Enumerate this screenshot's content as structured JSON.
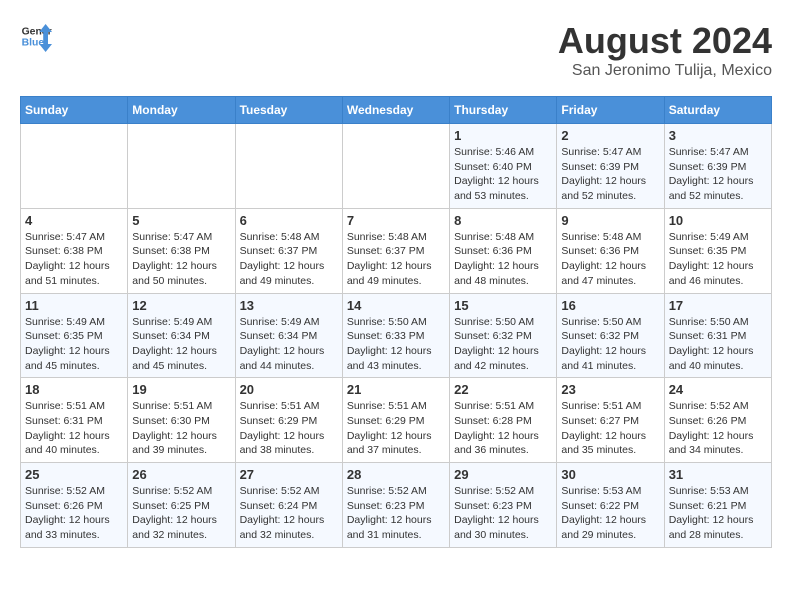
{
  "header": {
    "logo_text_general": "General",
    "logo_text_blue": "Blue",
    "month_year": "August 2024",
    "location": "San Jeronimo Tulija, Mexico"
  },
  "days_of_week": [
    "Sunday",
    "Monday",
    "Tuesday",
    "Wednesday",
    "Thursday",
    "Friday",
    "Saturday"
  ],
  "weeks": [
    [
      {
        "day": "",
        "info": ""
      },
      {
        "day": "",
        "info": ""
      },
      {
        "day": "",
        "info": ""
      },
      {
        "day": "",
        "info": ""
      },
      {
        "day": "1",
        "info": "Sunrise: 5:46 AM\nSunset: 6:40 PM\nDaylight: 12 hours\nand 53 minutes."
      },
      {
        "day": "2",
        "info": "Sunrise: 5:47 AM\nSunset: 6:39 PM\nDaylight: 12 hours\nand 52 minutes."
      },
      {
        "day": "3",
        "info": "Sunrise: 5:47 AM\nSunset: 6:39 PM\nDaylight: 12 hours\nand 52 minutes."
      }
    ],
    [
      {
        "day": "4",
        "info": "Sunrise: 5:47 AM\nSunset: 6:38 PM\nDaylight: 12 hours\nand 51 minutes."
      },
      {
        "day": "5",
        "info": "Sunrise: 5:47 AM\nSunset: 6:38 PM\nDaylight: 12 hours\nand 50 minutes."
      },
      {
        "day": "6",
        "info": "Sunrise: 5:48 AM\nSunset: 6:37 PM\nDaylight: 12 hours\nand 49 minutes."
      },
      {
        "day": "7",
        "info": "Sunrise: 5:48 AM\nSunset: 6:37 PM\nDaylight: 12 hours\nand 49 minutes."
      },
      {
        "day": "8",
        "info": "Sunrise: 5:48 AM\nSunset: 6:36 PM\nDaylight: 12 hours\nand 48 minutes."
      },
      {
        "day": "9",
        "info": "Sunrise: 5:48 AM\nSunset: 6:36 PM\nDaylight: 12 hours\nand 47 minutes."
      },
      {
        "day": "10",
        "info": "Sunrise: 5:49 AM\nSunset: 6:35 PM\nDaylight: 12 hours\nand 46 minutes."
      }
    ],
    [
      {
        "day": "11",
        "info": "Sunrise: 5:49 AM\nSunset: 6:35 PM\nDaylight: 12 hours\nand 45 minutes."
      },
      {
        "day": "12",
        "info": "Sunrise: 5:49 AM\nSunset: 6:34 PM\nDaylight: 12 hours\nand 45 minutes."
      },
      {
        "day": "13",
        "info": "Sunrise: 5:49 AM\nSunset: 6:34 PM\nDaylight: 12 hours\nand 44 minutes."
      },
      {
        "day": "14",
        "info": "Sunrise: 5:50 AM\nSunset: 6:33 PM\nDaylight: 12 hours\nand 43 minutes."
      },
      {
        "day": "15",
        "info": "Sunrise: 5:50 AM\nSunset: 6:32 PM\nDaylight: 12 hours\nand 42 minutes."
      },
      {
        "day": "16",
        "info": "Sunrise: 5:50 AM\nSunset: 6:32 PM\nDaylight: 12 hours\nand 41 minutes."
      },
      {
        "day": "17",
        "info": "Sunrise: 5:50 AM\nSunset: 6:31 PM\nDaylight: 12 hours\nand 40 minutes."
      }
    ],
    [
      {
        "day": "18",
        "info": "Sunrise: 5:51 AM\nSunset: 6:31 PM\nDaylight: 12 hours\nand 40 minutes."
      },
      {
        "day": "19",
        "info": "Sunrise: 5:51 AM\nSunset: 6:30 PM\nDaylight: 12 hours\nand 39 minutes."
      },
      {
        "day": "20",
        "info": "Sunrise: 5:51 AM\nSunset: 6:29 PM\nDaylight: 12 hours\nand 38 minutes."
      },
      {
        "day": "21",
        "info": "Sunrise: 5:51 AM\nSunset: 6:29 PM\nDaylight: 12 hours\nand 37 minutes."
      },
      {
        "day": "22",
        "info": "Sunrise: 5:51 AM\nSunset: 6:28 PM\nDaylight: 12 hours\nand 36 minutes."
      },
      {
        "day": "23",
        "info": "Sunrise: 5:51 AM\nSunset: 6:27 PM\nDaylight: 12 hours\nand 35 minutes."
      },
      {
        "day": "24",
        "info": "Sunrise: 5:52 AM\nSunset: 6:26 PM\nDaylight: 12 hours\nand 34 minutes."
      }
    ],
    [
      {
        "day": "25",
        "info": "Sunrise: 5:52 AM\nSunset: 6:26 PM\nDaylight: 12 hours\nand 33 minutes."
      },
      {
        "day": "26",
        "info": "Sunrise: 5:52 AM\nSunset: 6:25 PM\nDaylight: 12 hours\nand 32 minutes."
      },
      {
        "day": "27",
        "info": "Sunrise: 5:52 AM\nSunset: 6:24 PM\nDaylight: 12 hours\nand 32 minutes."
      },
      {
        "day": "28",
        "info": "Sunrise: 5:52 AM\nSunset: 6:23 PM\nDaylight: 12 hours\nand 31 minutes."
      },
      {
        "day": "29",
        "info": "Sunrise: 5:52 AM\nSunset: 6:23 PM\nDaylight: 12 hours\nand 30 minutes."
      },
      {
        "day": "30",
        "info": "Sunrise: 5:53 AM\nSunset: 6:22 PM\nDaylight: 12 hours\nand 29 minutes."
      },
      {
        "day": "31",
        "info": "Sunrise: 5:53 AM\nSunset: 6:21 PM\nDaylight: 12 hours\nand 28 minutes."
      }
    ]
  ]
}
